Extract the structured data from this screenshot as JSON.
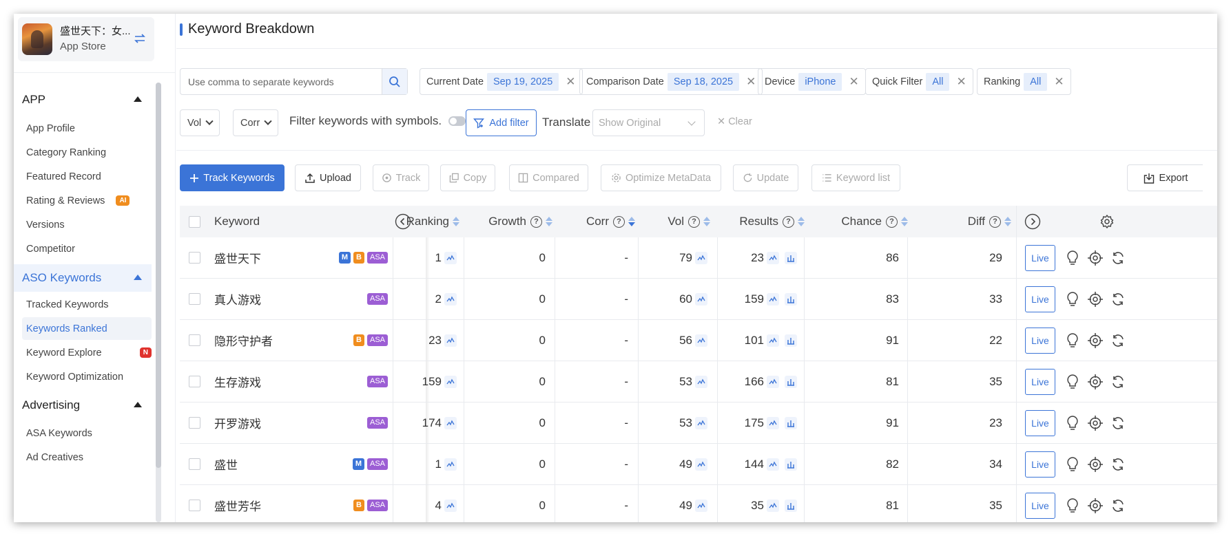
{
  "sidebar": {
    "app_title": "盛世天下：女...",
    "app_store": "App Store",
    "sections": [
      {
        "label": "APP",
        "items": [
          "App Profile",
          "Category Ranking",
          "Featured Record",
          "Rating & Reviews",
          "Versions",
          "Competitor"
        ]
      },
      {
        "label": "ASO Keywords",
        "items": [
          "Tracked Keywords",
          "Keywords Ranked",
          "Keyword Explore",
          "Keyword Optimization"
        ]
      },
      {
        "label": "Advertising",
        "items": [
          "ASA Keywords",
          "Ad Creatives"
        ]
      }
    ],
    "badge_ai": "AI",
    "badge_new": "N"
  },
  "page": {
    "title": "Keyword Breakdown"
  },
  "filters": {
    "search_placeholder": "Use comma to separate keywords",
    "current_date_label": "Current Date",
    "current_date_value": "Sep 19, 2025",
    "comparison_date_label": "Comparison Date",
    "comparison_date_value": "Sep 18, 2025",
    "device_label": "Device",
    "device_value": "iPhone",
    "quick_filter_label": "Quick Filter",
    "quick_filter_value": "All",
    "ranking_label": "Ranking",
    "ranking_value": "All",
    "vol_select": "Vol",
    "corr_select": "Corr",
    "filter_symbols_label": "Filter keywords with symbols.",
    "add_filter": "Add filter",
    "translate_label": "Translate",
    "translate_value": "Show Original",
    "clear": "Clear"
  },
  "toolbar": {
    "track_keywords": "Track Keywords",
    "upload": "Upload",
    "track": "Track",
    "copy": "Copy",
    "compared": "Compared",
    "optimize": "Optimize MetaData",
    "update": "Update",
    "keyword_list": "Keyword list",
    "export": "Export"
  },
  "table": {
    "columns": {
      "keyword": "Keyword",
      "ranking": "Ranking",
      "growth": "Growth",
      "corr": "Corr",
      "vol": "Vol",
      "results": "Results",
      "chance": "Chance",
      "diff": "Diff"
    },
    "live_label": "Live",
    "rows": [
      {
        "keyword": "盛世天下",
        "tags": [
          "M",
          "B",
          "ASA"
        ],
        "ranking": "1",
        "growth": "0",
        "corr": "-",
        "vol": "79",
        "results": "23",
        "chance": "86",
        "diff": "29"
      },
      {
        "keyword": "真人游戏",
        "tags": [
          "ASA"
        ],
        "ranking": "2",
        "growth": "0",
        "corr": "-",
        "vol": "60",
        "results": "159",
        "chance": "83",
        "diff": "33"
      },
      {
        "keyword": "隐形守护者",
        "tags": [
          "B",
          "ASA"
        ],
        "ranking": "23",
        "growth": "0",
        "corr": "-",
        "vol": "56",
        "results": "101",
        "chance": "91",
        "diff": "22"
      },
      {
        "keyword": "生存游戏",
        "tags": [
          "ASA"
        ],
        "ranking": "159",
        "growth": "0",
        "corr": "-",
        "vol": "53",
        "results": "166",
        "chance": "81",
        "diff": "35"
      },
      {
        "keyword": "开罗游戏",
        "tags": [
          "ASA"
        ],
        "ranking": "174",
        "growth": "0",
        "corr": "-",
        "vol": "53",
        "results": "175",
        "chance": "91",
        "diff": "23"
      },
      {
        "keyword": "盛世",
        "tags": [
          "M",
          "ASA"
        ],
        "ranking": "1",
        "growth": "0",
        "corr": "-",
        "vol": "49",
        "results": "144",
        "chance": "82",
        "diff": "34"
      },
      {
        "keyword": "盛世芳华",
        "tags": [
          "B",
          "ASA"
        ],
        "ranking": "4",
        "growth": "0",
        "corr": "-",
        "vol": "49",
        "results": "35",
        "chance": "81",
        "diff": "35"
      }
    ]
  },
  "colors": {
    "accent": "#3b74d7",
    "tag_m": "#3b74d7",
    "tag_b": "#f08d1e",
    "tag_asa": "#9c5ed4"
  }
}
